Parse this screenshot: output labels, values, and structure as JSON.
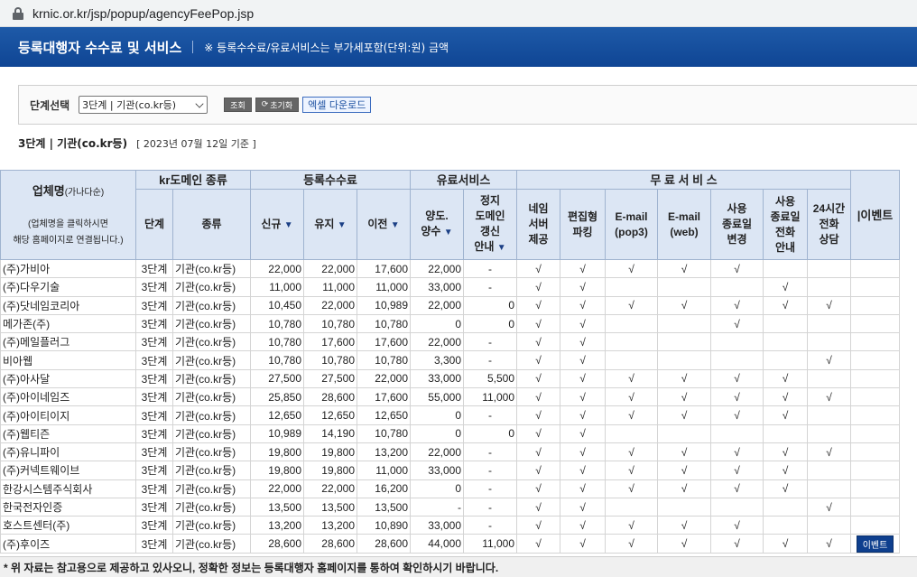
{
  "browser": {
    "url": "krnic.or.kr/jsp/popup/agencyFeePop.jsp"
  },
  "header": {
    "title": "등록대행자 수수료 및 서비스",
    "note": "※ 등록수수료/유료서비스는 부가세포함(단위:원) 금액"
  },
  "filter": {
    "label": "단계선택",
    "selected": "3단계 | 기관(co.kr등)",
    "search_label": "조회",
    "reset_label": "초기화",
    "excel_label": "엑셀 다운로드"
  },
  "subtitle": {
    "stage": "3단계 | 기관(co.kr등)",
    "date": "[ 2023년 07월 12일 기준 ]"
  },
  "table": {
    "group_headers": {
      "name": "업체명",
      "name_hint": "(가나다순)",
      "name_note1": "(업체명을 클릭하시면",
      "name_note2": "해당 홈페이지로 연결됩니다.)",
      "domain": "kr도메인 종류",
      "fees": "등록수수료",
      "paid": "유료서비스",
      "free": "무 료 서 비 스",
      "event": "|이벤트"
    },
    "sub_headers": {
      "stage": "단계",
      "type": "종류",
      "new": "신규",
      "renew": "유지",
      "transfer": "이전",
      "assign1": "양도.",
      "assign2": "양수",
      "suspend1": "정지",
      "suspend2": "도메인",
      "suspend3": "갱신",
      "suspend4": "안내",
      "ns1": "네임",
      "ns2": "서버",
      "ns3": "제공",
      "park1": "편집형",
      "park2": "파킹",
      "pop1": "E-mail",
      "pop2": "(pop3)",
      "web1": "E-mail",
      "web2": "(web)",
      "exp1": "사용",
      "exp2": "종료일",
      "exp3": "변경",
      "call1": "사용",
      "call2": "종료일",
      "call3": "전화",
      "call4": "안내",
      "h1": "24시간",
      "h2": "전화",
      "h3": "상담"
    },
    "sort_icon": "▼",
    "rows": [
      {
        "name": "(주)가비아",
        "stage": "3단계",
        "type": "기관(co.kr등)",
        "new": "22,000",
        "renew": "22,000",
        "transfer": "17,600",
        "assign": "22,000",
        "suspend": "-",
        "ns": "√",
        "park": "√",
        "pop": "√",
        "web": "√",
        "exp": "√",
        "call": "",
        "h24": "",
        "event": ""
      },
      {
        "name": "(주)다우기술",
        "stage": "3단계",
        "type": "기관(co.kr등)",
        "new": "11,000",
        "renew": "11,000",
        "transfer": "11,000",
        "assign": "33,000",
        "suspend": "-",
        "ns": "√",
        "park": "√",
        "pop": "",
        "web": "",
        "exp": "",
        "call": "√",
        "h24": "",
        "event": ""
      },
      {
        "name": "(주)닷네임코리아",
        "stage": "3단계",
        "type": "기관(co.kr등)",
        "new": "10,450",
        "renew": "22,000",
        "transfer": "10,989",
        "assign": "22,000",
        "suspend": "0",
        "ns": "√",
        "park": "√",
        "pop": "√",
        "web": "√",
        "exp": "√",
        "call": "√",
        "h24": "√",
        "event": ""
      },
      {
        "name": "메가존(주)",
        "stage": "3단계",
        "type": "기관(co.kr등)",
        "new": "10,780",
        "renew": "10,780",
        "transfer": "10,780",
        "assign": "0",
        "suspend": "0",
        "ns": "√",
        "park": "√",
        "pop": "",
        "web": "",
        "exp": "√",
        "call": "",
        "h24": "",
        "event": ""
      },
      {
        "name": "(주)메일플러그",
        "stage": "3단계",
        "type": "기관(co.kr등)",
        "new": "10,780",
        "renew": "17,600",
        "transfer": "17,600",
        "assign": "22,000",
        "suspend": "-",
        "ns": "√",
        "park": "√",
        "pop": "",
        "web": "",
        "exp": "",
        "call": "",
        "h24": "",
        "event": ""
      },
      {
        "name": "비아웹",
        "stage": "3단계",
        "type": "기관(co.kr등)",
        "new": "10,780",
        "renew": "10,780",
        "transfer": "10,780",
        "assign": "3,300",
        "suspend": "-",
        "ns": "√",
        "park": "√",
        "pop": "",
        "web": "",
        "exp": "",
        "call": "",
        "h24": "√",
        "event": ""
      },
      {
        "name": "(주)아사달",
        "stage": "3단계",
        "type": "기관(co.kr등)",
        "new": "27,500",
        "renew": "27,500",
        "transfer": "22,000",
        "assign": "33,000",
        "suspend": "5,500",
        "ns": "√",
        "park": "√",
        "pop": "√",
        "web": "√",
        "exp": "√",
        "call": "√",
        "h24": "",
        "event": ""
      },
      {
        "name": "(주)아이네임즈",
        "stage": "3단계",
        "type": "기관(co.kr등)",
        "new": "25,850",
        "renew": "28,600",
        "transfer": "17,600",
        "assign": "55,000",
        "suspend": "11,000",
        "ns": "√",
        "park": "√",
        "pop": "√",
        "web": "√",
        "exp": "√",
        "call": "√",
        "h24": "√",
        "event": ""
      },
      {
        "name": "(주)아이티이지",
        "stage": "3단계",
        "type": "기관(co.kr등)",
        "new": "12,650",
        "renew": "12,650",
        "transfer": "12,650",
        "assign": "0",
        "suspend": "-",
        "ns": "√",
        "park": "√",
        "pop": "√",
        "web": "√",
        "exp": "√",
        "call": "√",
        "h24": "",
        "event": ""
      },
      {
        "name": "(주)웹티즌",
        "stage": "3단계",
        "type": "기관(co.kr등)",
        "new": "10,989",
        "renew": "14,190",
        "transfer": "10,780",
        "assign": "0",
        "suspend": "0",
        "ns": "√",
        "park": "√",
        "pop": "",
        "web": "",
        "exp": "",
        "call": "",
        "h24": "",
        "event": ""
      },
      {
        "name": "(주)유니파이",
        "stage": "3단계",
        "type": "기관(co.kr등)",
        "new": "19,800",
        "renew": "19,800",
        "transfer": "13,200",
        "assign": "22,000",
        "suspend": "-",
        "ns": "√",
        "park": "√",
        "pop": "√",
        "web": "√",
        "exp": "√",
        "call": "√",
        "h24": "√",
        "event": ""
      },
      {
        "name": "(주)커넥트웨이브",
        "stage": "3단계",
        "type": "기관(co.kr등)",
        "new": "19,800",
        "renew": "19,800",
        "transfer": "11,000",
        "assign": "33,000",
        "suspend": "-",
        "ns": "√",
        "park": "√",
        "pop": "√",
        "web": "√",
        "exp": "√",
        "call": "√",
        "h24": "",
        "event": ""
      },
      {
        "name": "한강시스템주식회사",
        "stage": "3단계",
        "type": "기관(co.kr등)",
        "new": "22,000",
        "renew": "22,000",
        "transfer": "16,200",
        "assign": "0",
        "suspend": "-",
        "ns": "√",
        "park": "√",
        "pop": "√",
        "web": "√",
        "exp": "√",
        "call": "√",
        "h24": "",
        "event": ""
      },
      {
        "name": "한국전자인증",
        "stage": "3단계",
        "type": "기관(co.kr등)",
        "new": "13,500",
        "renew": "13,500",
        "transfer": "13,500",
        "assign": "-",
        "suspend": "-",
        "ns": "√",
        "park": "√",
        "pop": "",
        "web": "",
        "exp": "",
        "call": "",
        "h24": "√",
        "event": ""
      },
      {
        "name": "호스트센터(주)",
        "stage": "3단계",
        "type": "기관(co.kr등)",
        "new": "13,200",
        "renew": "13,200",
        "transfer": "10,890",
        "assign": "33,000",
        "suspend": "-",
        "ns": "√",
        "park": "√",
        "pop": "√",
        "web": "√",
        "exp": "√",
        "call": "",
        "h24": "",
        "event": ""
      },
      {
        "name": "(주)후이즈",
        "stage": "3단계",
        "type": "기관(co.kr등)",
        "new": "28,600",
        "renew": "28,600",
        "transfer": "28,600",
        "assign": "44,000",
        "suspend": "11,000",
        "ns": "√",
        "park": "√",
        "pop": "√",
        "web": "√",
        "exp": "√",
        "call": "√",
        "h24": "√",
        "event": "이벤트"
      }
    ]
  },
  "footer": "* 위 자료는 참고용으로 제공하고 있사오니, 정확한 정보는 등록대행자 홈페이지를 통하여 확인하시기 바랍니다."
}
